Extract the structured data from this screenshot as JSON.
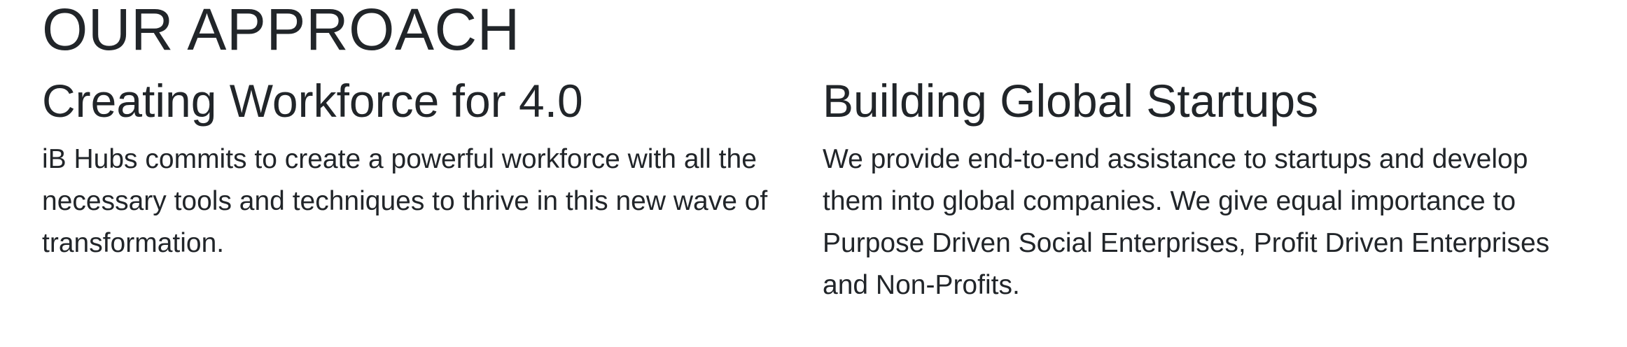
{
  "section": {
    "title": "OUR APPROACH"
  },
  "columns": [
    {
      "heading": "Creating Workforce for 4.0",
      "lines": [
        "iB Hubs commits to create a powerful workforce with all the",
        "necessary tools and techniques to thrive in this new wave of",
        "transformation."
      ]
    },
    {
      "heading": "Building Global Startups",
      "lines": [
        "We provide end-to-end assistance to startups and develop",
        "them into global companies. We give equal importance to",
        "Purpose Driven Social Enterprises, Profit Driven Enterprises",
        "and Non-Profits."
      ]
    }
  ]
}
